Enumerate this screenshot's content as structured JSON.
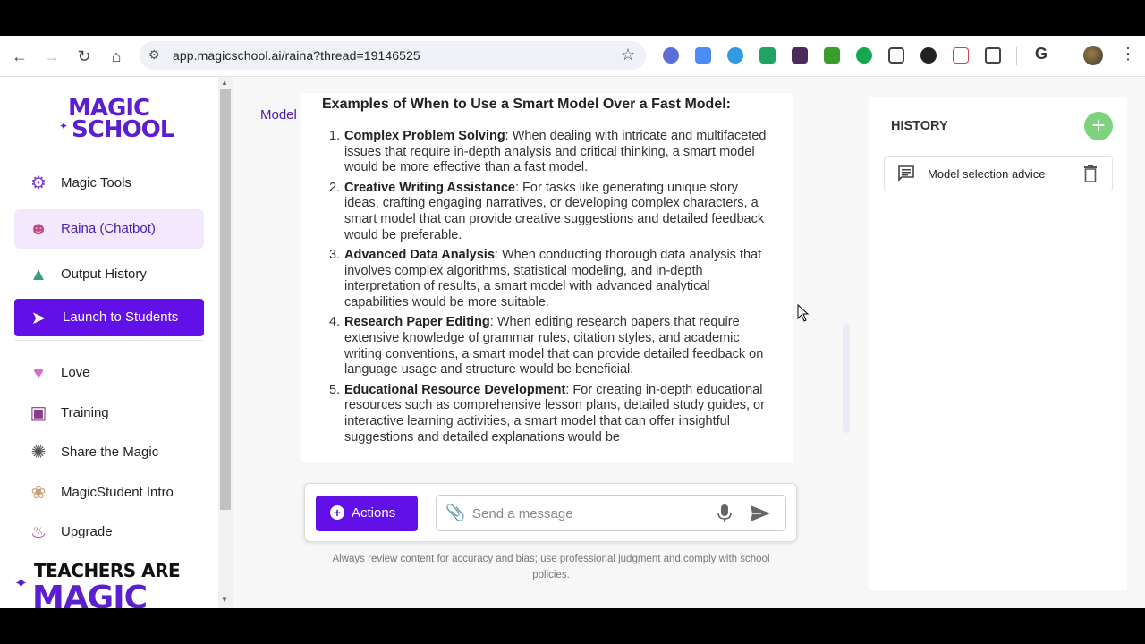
{
  "browser": {
    "url": "app.magicschool.ai/raina?thread=19146525"
  },
  "sidebar": {
    "logo_line1": "MAGIC",
    "logo_line2": "SCHOOL",
    "items": [
      {
        "label": "Magic Tools",
        "icon": "magic-tools-icon"
      },
      {
        "label": "Raina (Chatbot)",
        "icon": "raina-icon"
      },
      {
        "label": "Output History",
        "icon": "output-history-icon"
      },
      {
        "label": "Launch to Students",
        "icon": "rocket-icon"
      },
      {
        "label": "Love",
        "icon": "heart-icon"
      },
      {
        "label": "Training",
        "icon": "easel-icon"
      },
      {
        "label": "Share the Magic",
        "icon": "sparkle-icon"
      },
      {
        "label": "MagicStudent Intro",
        "icon": "bunny-icon"
      },
      {
        "label": "Upgrade",
        "icon": "potion-icon"
      }
    ],
    "slogan_line1": "TEACHERS ARE",
    "slogan_line2": "MAGIC"
  },
  "chat": {
    "model_label": "Model",
    "heading": "Examples of When to Use a Smart Model Over a Fast Model:",
    "items": [
      {
        "num": "1.",
        "title": "Complex Problem Solving",
        "text": ": When dealing with intricate and multifaceted issues that require in-depth analysis and critical thinking, a smart model would be more effective than a fast model."
      },
      {
        "num": "2.",
        "title": "Creative Writing Assistance",
        "text": ": For tasks like generating unique story ideas, crafting engaging narratives, or developing complex characters, a smart model that can provide creative suggestions and detailed feedback would be preferable."
      },
      {
        "num": "3.",
        "title": "Advanced Data Analysis",
        "text": ": When conducting thorough data analysis that involves complex algorithms, statistical modeling, and in-depth interpretation of results, a smart model with advanced analytical capabilities would be more suitable."
      },
      {
        "num": "4.",
        "title": "Research Paper Editing",
        "text": ": When editing research papers that require extensive knowledge of grammar rules, citation styles, and academic writing conventions, a smart model that can provide detailed feedback on language usage and structure would be beneficial."
      },
      {
        "num": "5.",
        "title": "Educational Resource Development",
        "text": ": For creating in-depth educational resources such as comprehensive lesson plans, detailed study guides, or interactive learning activities, a smart model that can offer insightful suggestions and detailed explanations would be"
      }
    ],
    "actions_label": "Actions",
    "message_placeholder": "Send a message",
    "disclaimer": "Always review content for accuracy and bias; use professional judgment and comply with school policies."
  },
  "history": {
    "title": "HISTORY",
    "items": [
      {
        "label": "Model selection advice"
      }
    ]
  },
  "colors": {
    "brand_purple": "#6111e8",
    "active_bg": "#f3e8fd",
    "add_green": "#7ed27d"
  }
}
